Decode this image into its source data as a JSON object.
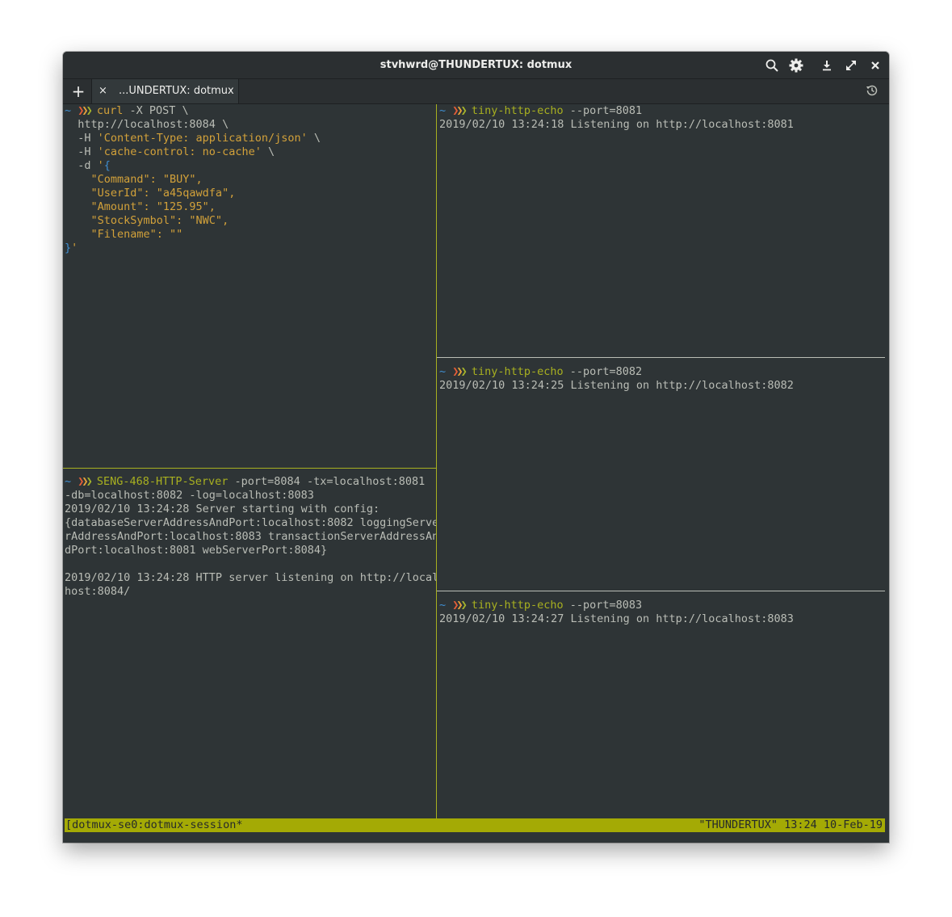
{
  "window": {
    "title": "stvhwrd@THUNDERTUX: dotmux",
    "buttons": [
      "search-icon",
      "gear-icon",
      "download-icon",
      "maximize-icon",
      "close-icon"
    ]
  },
  "tabbar": {
    "add_label": "+",
    "tab_close_label": "×",
    "tab_label": "...UNDERTUX: dotmux"
  },
  "prompt": {
    "tilde": "~",
    "chevron": "❯❯❯"
  },
  "pane_curl": {
    "command": "curl",
    "first_args": " -X POST \\",
    "lines": [
      "  http://localhost:8084 \\"
    ],
    "h1_flag": "  -H ",
    "h1_value": "'Content-Type: application/json'",
    "h1_tail": " \\",
    "h2_flag": "  -H ",
    "h2_value": "'cache-control: no-cache'",
    "h2_tail": " \\",
    "d_flag": "  -d ",
    "d_quote": "'",
    "d_brace": "{",
    "json_lines": [
      "    \"Command\": \"BUY\",",
      "    \"UserId\": \"a45qawdfa\",",
      "    \"Amount\": \"125.95\",",
      "    \"StockSymbol\": \"NWC\",",
      "    \"Filename\": \"\""
    ],
    "close_brace": "}",
    "close_quote": "'"
  },
  "pane_server": {
    "command": "SENG-468-HTTP-Server",
    "first_args": " -port=8084 -tx=localhost:8081",
    "output": [
      "-db=localhost:8082 -log=localhost:8083",
      "2019/02/10 13:24:28 Server starting with config:",
      "{databaseServerAddressAndPort:localhost:8082 loggingServe",
      "rAddressAndPort:localhost:8083 transactionServerAddressAn",
      "dPort:localhost:8081 webServerPort:8084}",
      "",
      "2019/02/10 13:24:28 HTTP server listening on http://local",
      "host:8084/"
    ]
  },
  "pane_echo1": {
    "command": "tiny-http-echo",
    "args": " --port=8081",
    "output": "2019/02/10 13:24:18 Listening on http://localhost:8081"
  },
  "pane_echo2": {
    "command": "tiny-http-echo",
    "args": " --port=8082",
    "output": "2019/02/10 13:24:25 Listening on http://localhost:8082"
  },
  "pane_echo3": {
    "command": "tiny-http-echo",
    "args": " --port=8083",
    "output": "2019/02/10 13:24:27 Listening on http://localhost:8083"
  },
  "statusbar": {
    "left": "[dotmux-se0:dotmux-session*",
    "right": "\"THUNDERTUX\" 13:24 10-Feb-19"
  },
  "colors": {
    "terminal_bg": "#2e3436",
    "status_bg": "#a4aa05",
    "active_border": "#a8b020",
    "prompt_blue": "#3f8fd2",
    "string_yellow": "#d2a13a"
  }
}
